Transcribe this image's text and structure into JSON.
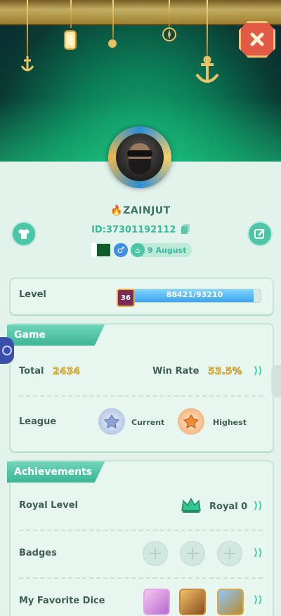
{
  "header": {
    "close_icon": "close-x-icon"
  },
  "profile": {
    "name": "🔥ZAINJUT",
    "id_text": "ID:37301192112",
    "copy_icon": "copy-icon",
    "left_button_icon": "shirt-icon",
    "right_button_icon": "edit-icon",
    "flag_icon": "pakistan-flag-icon",
    "gender_symbol": "♂",
    "birthday_icon": "cake-icon",
    "birthday": "9 August"
  },
  "level": {
    "label": "Level",
    "level_number": "36",
    "progress_text": "88421/93210",
    "progress_fraction": 0.949
  },
  "game": {
    "tab_label": "Game",
    "total_label": "Total",
    "total_value": "2434",
    "win_rate_label": "Win Rate",
    "win_rate_value": "53.5%",
    "league_label": "League",
    "current_label": "Current",
    "highest_label": "Highest"
  },
  "achievements": {
    "tab_label": "Achievements",
    "royal_level_label": "Royal Level",
    "royal_value": "Royal 0",
    "badges_label": "Badges",
    "favorite_dice_label": "My Favorite Dice"
  },
  "colors": {
    "accent": "#45c9a4",
    "gold": "#f2c94c",
    "close": "#e25a45",
    "progress": "#3ea4ea"
  }
}
